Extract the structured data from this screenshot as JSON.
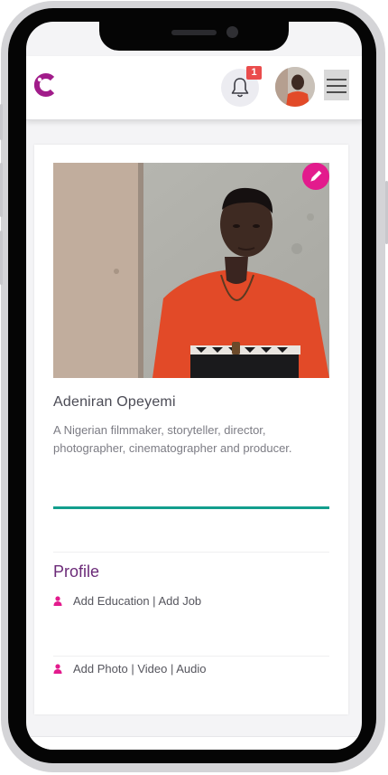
{
  "header": {
    "notification_count": "1",
    "logo_icon": "c-logo-icon",
    "colors": {
      "logo": "#a11c8a",
      "badge": "#ea4c4c"
    }
  },
  "profile": {
    "name": "Adeniran Opeyemi",
    "bio": "A Nigerian filmmaker, storyteller, director, photographer, cinematographer and producer.",
    "edit_icon": "pencil-icon",
    "accent_color": "#129e8d"
  },
  "section": {
    "title": "Profile",
    "links": [
      {
        "icon": "person-icon",
        "label": "Add Education | Add Job"
      },
      {
        "icon": "person-icon",
        "label": "Add Photo | Video | Audio"
      }
    ],
    "colors": {
      "title": "#6b2a78",
      "icon": "#e31b8d"
    }
  }
}
